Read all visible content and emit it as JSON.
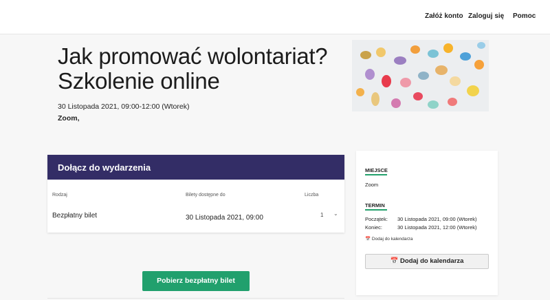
{
  "nav": {
    "register": "Załóż konto",
    "login": "Zaloguj się",
    "help": "Pomoc"
  },
  "event": {
    "title": "Jak promować wolontariat? Szkolenie online",
    "date": "30 Listopada 2021, 09:00-12:00 (Wtorek)",
    "place": "Zoom,"
  },
  "tickets": {
    "header": "Dołącz do wydarzenia",
    "columns": [
      "Rodzaj",
      "Bilety dostępne do",
      "Liczba"
    ],
    "row": {
      "type": "Bezpłatny bilet",
      "available_until": "30 Listopada 2021, 09:00",
      "quantity": "1"
    }
  },
  "sidebar": {
    "place_heading": "MIEJSCE",
    "place_value": "Zoom",
    "term_heading": "TERMIN",
    "start_label": "Początek:",
    "start_value": "30 Listopada 2021, 09:00 (Wtorek)",
    "end_label": "Koniec:",
    "end_value": "30 Listopada 2021, 12:00 (Wtorek)",
    "calendar_link": "Dodaj do kalendarza",
    "calendar_button": "Dodaj do kalendarza"
  },
  "actions": {
    "get_ticket": "Pobierz bezpłatny bilet"
  },
  "colors": {
    "header_bg": "#332d66",
    "accent": "#21a06d"
  }
}
